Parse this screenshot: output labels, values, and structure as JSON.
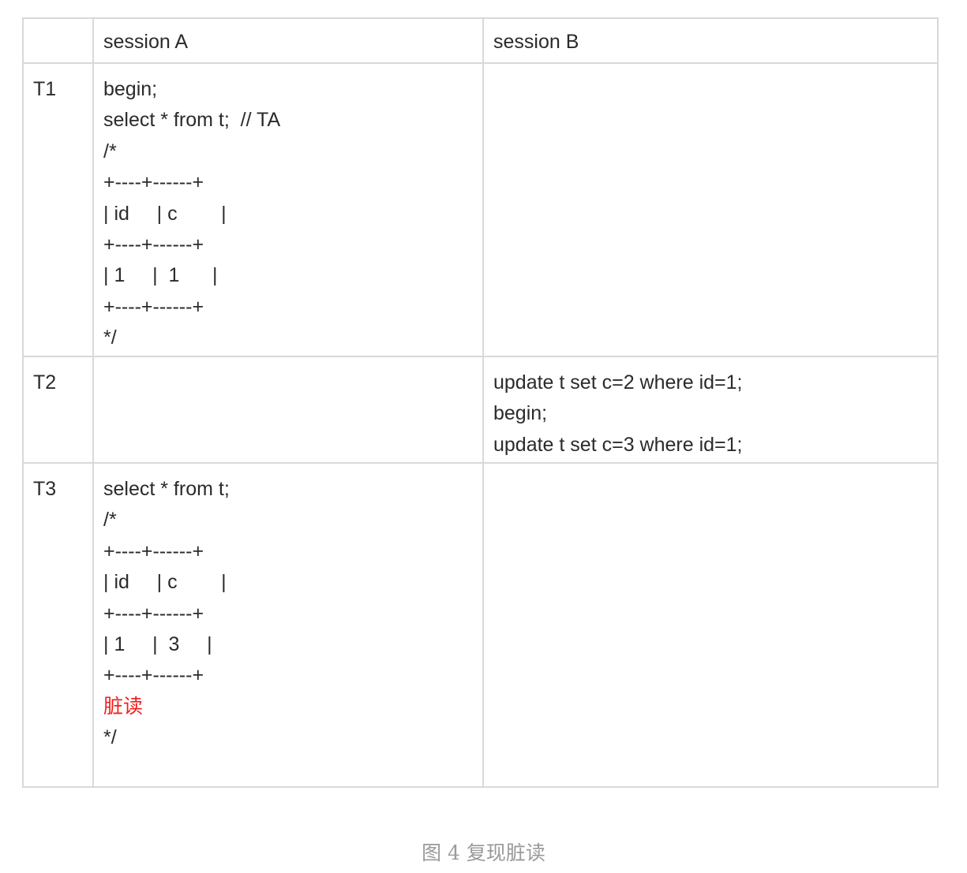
{
  "table": {
    "header": [
      "",
      "session A",
      "session B"
    ],
    "rows": [
      {
        "time": "T1",
        "session_a": [
          "begin;",
          "select * from t;  // TA",
          "/*",
          "+----+------+",
          "| id     | c        |",
          "+----+------+",
          "| 1     |  1      |",
          "+----+------+",
          "*/"
        ],
        "session_b": []
      },
      {
        "time": "T2",
        "session_a": [],
        "session_b": [
          "update t set c=2 where id=1;",
          "begin;",
          "update t set c=3 where id=1;"
        ]
      },
      {
        "time": "T3",
        "session_a": [
          "select * from t;",
          "/*",
          "+----+------+",
          "| id     | c        |",
          "+----+------+",
          "| 1     |  3     |",
          "+----+------+",
          "脏读",
          "*/"
        ],
        "session_b": []
      }
    ]
  },
  "highlight_color": "#f0201c",
  "caption": "图 4 复现脏读"
}
